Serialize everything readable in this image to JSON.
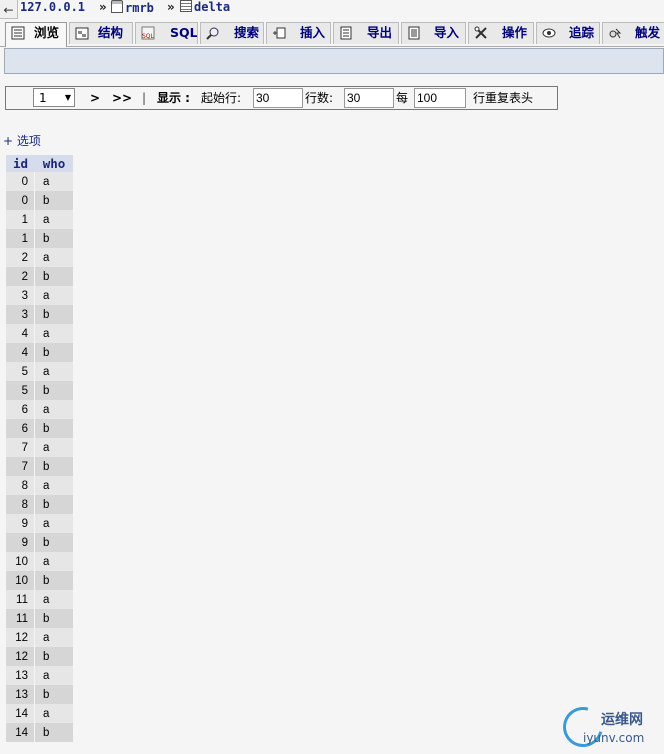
{
  "breadcrumb": {
    "back": "←",
    "server": "127.0.0.1",
    "database": "rmrb",
    "table": "delta",
    "separator": "»"
  },
  "tabs": [
    {
      "label": "浏览",
      "icon": "browse-icon",
      "active": true
    },
    {
      "label": "结构",
      "icon": "structure-icon",
      "active": false
    },
    {
      "label": "SQL",
      "icon": "sql-icon",
      "active": false
    },
    {
      "label": "搜索",
      "icon": "search-icon",
      "active": false
    },
    {
      "label": "插入",
      "icon": "insert-icon",
      "active": false
    },
    {
      "label": "导出",
      "icon": "export-icon",
      "active": false
    },
    {
      "label": "导入",
      "icon": "import-icon",
      "active": false
    },
    {
      "label": "操作",
      "icon": "operations-icon",
      "active": false
    },
    {
      "label": "追踪",
      "icon": "tracking-icon",
      "active": false
    },
    {
      "label": "触发",
      "icon": "triggers-icon",
      "active": false
    }
  ],
  "nav": {
    "page": "1",
    "next": ">",
    "last": ">>",
    "divider": "|",
    "show_label": "显示 :",
    "start_label": "起始行:",
    "start_value": "30",
    "rows_label": "行数:",
    "rows_value": "30",
    "every_label": "每",
    "every_value": "100",
    "repeat_label": "行重复表头"
  },
  "options_link": "+ 选项",
  "table": {
    "columns": [
      "id",
      "who"
    ],
    "rows": [
      [
        "0",
        "a"
      ],
      [
        "0",
        "b"
      ],
      [
        "1",
        "a"
      ],
      [
        "1",
        "b"
      ],
      [
        "2",
        "a"
      ],
      [
        "2",
        "b"
      ],
      [
        "3",
        "a"
      ],
      [
        "3",
        "b"
      ],
      [
        "4",
        "a"
      ],
      [
        "4",
        "b"
      ],
      [
        "5",
        "a"
      ],
      [
        "5",
        "b"
      ],
      [
        "6",
        "a"
      ],
      [
        "6",
        "b"
      ],
      [
        "7",
        "a"
      ],
      [
        "7",
        "b"
      ],
      [
        "8",
        "a"
      ],
      [
        "8",
        "b"
      ],
      [
        "9",
        "a"
      ],
      [
        "9",
        "b"
      ],
      [
        "10",
        "a"
      ],
      [
        "10",
        "b"
      ],
      [
        "11",
        "a"
      ],
      [
        "11",
        "b"
      ],
      [
        "12",
        "a"
      ],
      [
        "12",
        "b"
      ],
      [
        "13",
        "a"
      ],
      [
        "13",
        "b"
      ],
      [
        "14",
        "a"
      ],
      [
        "14",
        "b"
      ]
    ]
  },
  "watermark": {
    "line1": "运维网",
    "line2": "iyunv.com"
  },
  "colors": {
    "link": "#1a2a7a",
    "header_bg": "#d6dceb",
    "row_odd": "#e6e6e6",
    "row_even": "#d6d6d6"
  }
}
